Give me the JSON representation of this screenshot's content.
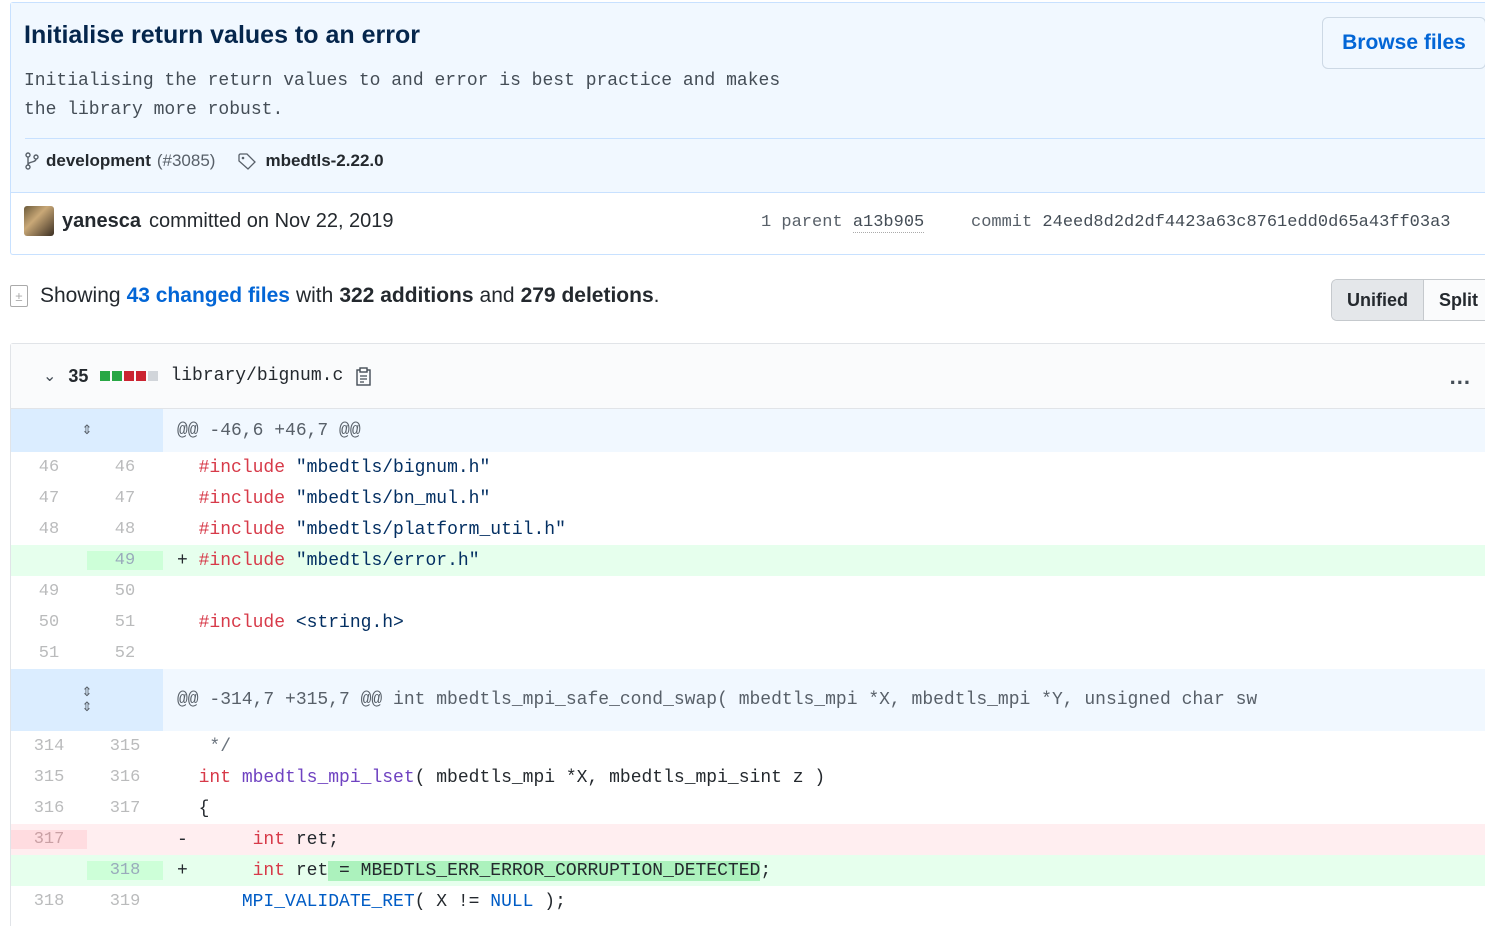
{
  "commit": {
    "title": "Initialise return values to an error",
    "description_line1": "Initialising the return values to and error is best practice and makes",
    "description_line2": "the library more robust.",
    "browse_label": "Browse files",
    "branch": "development",
    "pr": "(#3085)",
    "tag": "mbedtls-2.22.0",
    "author": "yanesca",
    "committed_text": "committed on Nov 22, 2019",
    "parent_prefix": "1 parent",
    "parent_sha": "a13b905",
    "commit_prefix": "commit",
    "commit_sha": "24eed8d2d2df4423a63c8761edd0d65a43ff03a3"
  },
  "summary": {
    "showing": "Showing",
    "changed": "43 changed files",
    "with": "with",
    "additions": "322 additions",
    "and": "and",
    "deletions": "279 deletions",
    "period": "."
  },
  "view_toggle": {
    "unified": "Unified",
    "split": "Split"
  },
  "file": {
    "count": "35",
    "path": "library/bignum.c",
    "more": "...",
    "bar_colors": [
      "#28a745",
      "#28a745",
      "#cb2431",
      "#cb2431",
      "#d1d5da"
    ]
  },
  "diff": {
    "hunk1": "@@ -46,6 +46,7 @@",
    "hunk2": "@@ -314,7 +315,7 @@ int mbedtls_mpi_safe_cond_swap( mbedtls_mpi *X, mbedtls_mpi *Y, unsigned char sw",
    "lines": [
      {
        "old": "46",
        "new": "46"
      },
      {
        "old": "47",
        "new": "47"
      },
      {
        "old": "48",
        "new": "48"
      },
      {
        "old": "",
        "new": "49"
      },
      {
        "old": "49",
        "new": "50"
      },
      {
        "old": "50",
        "new": "51"
      },
      {
        "old": "51",
        "new": "52"
      },
      {
        "old": "314",
        "new": "315"
      },
      {
        "old": "315",
        "new": "316"
      },
      {
        "old": "316",
        "new": "317"
      },
      {
        "old": "317",
        "new": ""
      },
      {
        "old": "",
        "new": "318"
      },
      {
        "old": "318",
        "new": "319"
      }
    ],
    "t": {
      "include": "#include",
      "s1": "\"mbedtls/bignum.h\"",
      "s2": "\"mbedtls/bn_mul.h\"",
      "s3": "\"mbedtls/platform_util.h\"",
      "s4": "\"mbedtls/error.h\"",
      "s5": "<string.h>",
      "cmt": " */",
      "int": "int",
      "fn": "mbedtls_mpi_lset",
      "fn_args": "( mbedtls_mpi *X, mbedtls_mpi_sint z )",
      "brace": "{",
      "ret": "ret;",
      "ret_plain": "ret",
      "assign": " = MBEDTLS_ERR_ERROR_CORRUPTION_DETECTED",
      "semi": ";",
      "validate": "MPI_VALIDATE_RET",
      "validate_args1": "( X != ",
      "null": "NULL",
      "validate_args2": " );",
      "plus": "+",
      "minus": "-"
    }
  }
}
